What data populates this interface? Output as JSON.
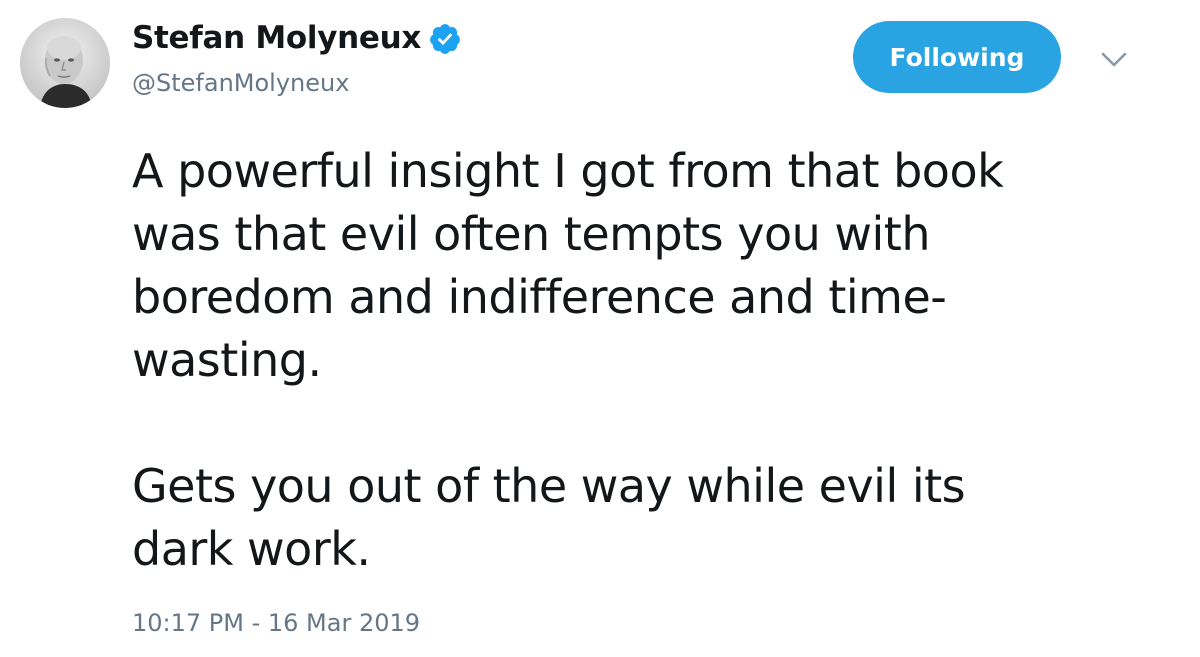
{
  "author": {
    "display_name": "Stefan Molyneux",
    "handle": "@StefanMolyneux",
    "verified": true,
    "avatar_icon": "profile-photo-avatar"
  },
  "actions": {
    "follow_label": "Following",
    "menu_icon": "chevron-down-icon"
  },
  "tweet": {
    "paragraph_1": "A powerful insight I got from that book\nwas that evil often tempts you with\nboredom and indifference and time-\nwasting.",
    "paragraph_2": "Gets you out of the way while evil its\ndark work.",
    "timestamp": "10:17 PM - 16 Mar 2019"
  },
  "colors": {
    "accent": "#2aa3e2",
    "text": "#14171a",
    "muted": "#657786"
  }
}
